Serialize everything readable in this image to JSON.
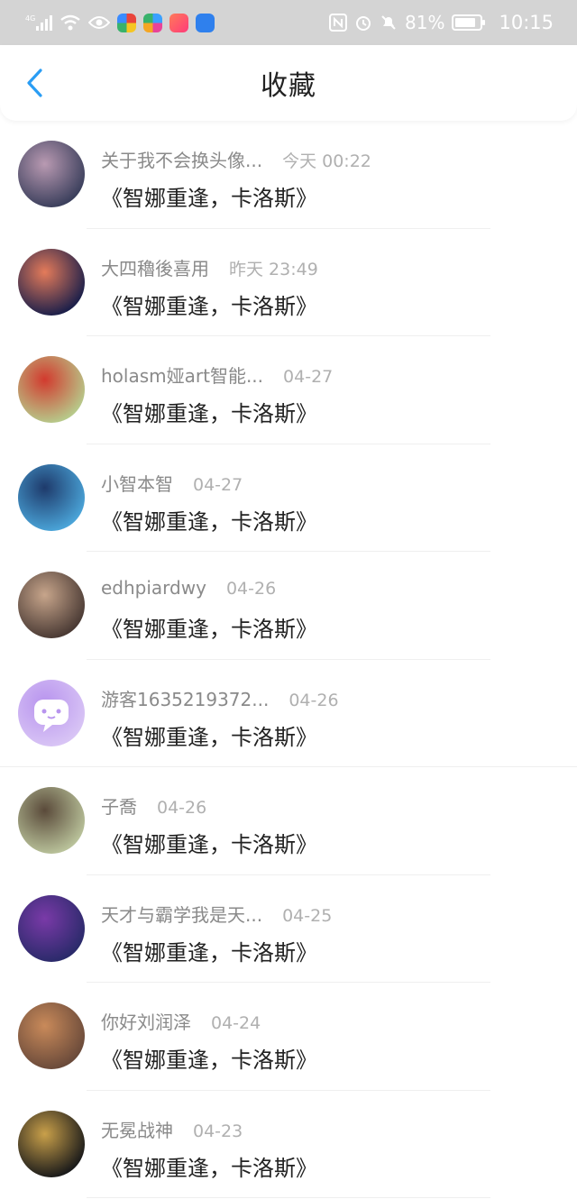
{
  "status_bar": {
    "network": "4G",
    "battery_percent": "81%",
    "time": "10:15",
    "app_icon_colors": [
      "#e9443b",
      "#f5a623",
      "#3aa0ff",
      "#2f80ed"
    ]
  },
  "header": {
    "title": "收藏",
    "back_icon": "chevron-left-icon",
    "accent_color": "#2a9df4"
  },
  "items": [
    {
      "username": "关于我不会换头像...",
      "time": "今天 00:22",
      "content": "《智娜重逢，卡洛斯》",
      "avatar_colors": [
        "#3b3f5c",
        "#b99ab2"
      ]
    },
    {
      "username": "大四穭後喜用",
      "time": "昨天 23:49",
      "content": "《智娜重逢，卡洛斯》",
      "avatar_colors": [
        "#1c1f4a",
        "#e47b5a"
      ]
    },
    {
      "username": "holasm娅art智能...",
      "time": "04-27",
      "content": "《智娜重逢，卡洛斯》",
      "avatar_colors": [
        "#b7c98a",
        "#d23a2e"
      ]
    },
    {
      "username": "小智本智",
      "time": "04-27",
      "content": "《智娜重逢，卡洛斯》",
      "avatar_colors": [
        "#4aa4d8",
        "#1e3a6b"
      ]
    },
    {
      "username": "edhpiardwy",
      "time": "04-26",
      "content": "《智娜重逢，卡洛斯》",
      "avatar_colors": [
        "#4a3a34",
        "#c7a58b"
      ]
    },
    {
      "username": "游客1635219372...",
      "time": "04-26",
      "content": "《智娜重逢，卡洛斯》",
      "avatar_colors": [
        "#d8c4f5",
        "#b894ee"
      ]
    },
    {
      "username": "子喬",
      "time": "04-26",
      "content": "《智娜重逢，卡洛斯》",
      "avatar_colors": [
        "#b9c29a",
        "#5a4a3a"
      ]
    },
    {
      "username": "天才与霸学我是天...",
      "time": "04-25",
      "content": "《智娜重逢，卡洛斯》",
      "avatar_colors": [
        "#2a2a6a",
        "#7a3aa8"
      ]
    },
    {
      "username": "你好刘润泽",
      "time": "04-24",
      "content": "《智娜重逢，卡洛斯》",
      "avatar_colors": [
        "#6a4a3a",
        "#c98a5a"
      ]
    },
    {
      "username": "无冕战神",
      "time": "04-23",
      "content": "《智娜重逢，卡洛斯》",
      "avatar_colors": [
        "#1a1a1a",
        "#c9a04a"
      ]
    }
  ]
}
